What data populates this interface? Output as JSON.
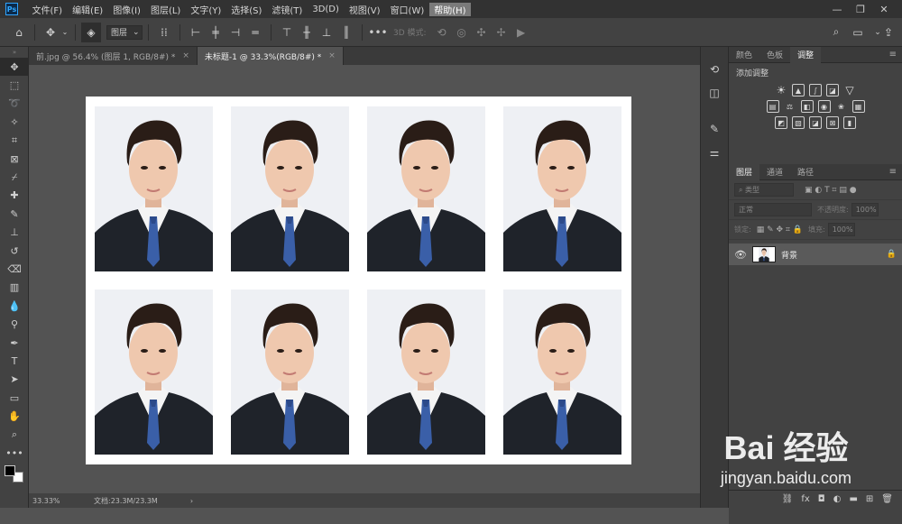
{
  "menubar": {
    "logo": "Ps",
    "items": [
      "文件(F)",
      "编辑(E)",
      "图像(I)",
      "图层(L)",
      "文字(Y)",
      "选择(S)",
      "滤镜(T)",
      "3D(D)",
      "视图(V)",
      "窗口(W)",
      "帮助(H)"
    ],
    "highlighted": "帮助(H)"
  },
  "options": {
    "layer_select": "图层",
    "threed_label": "3D 模式:"
  },
  "tabs": [
    {
      "label": "前.jpg @ 56.4% (图层 1, RGB/8#) *",
      "close": "×"
    },
    {
      "label": "未标题-1 @ 33.3%(RGB/8#) *",
      "close": "×"
    }
  ],
  "status": {
    "zoom": "33.33%",
    "doc": "文档:23.3M/23.3M",
    "arrow": "›"
  },
  "right": {
    "tabs_top": [
      "颜色",
      "色板",
      "调整"
    ],
    "adjust_title": "添加调整",
    "tabs_layers": [
      "通道",
      "路径"
    ],
    "layers_tab": "图层",
    "search_placeholder": "类型",
    "blend_mode": "正常",
    "opacity_label": "不透明度:",
    "opacity_value": "100%",
    "lock_label": "锁定:",
    "fill_label": "填充:",
    "fill_value": "100%",
    "layer_name": "背景"
  },
  "photos_count": 8,
  "watermark": {
    "main": "Bai 经验",
    "sub": "jingyan.baidu.com"
  },
  "colors": {
    "accent": "#31a8ff",
    "tie": "#3a5fa8",
    "suit": "#1f232a"
  }
}
